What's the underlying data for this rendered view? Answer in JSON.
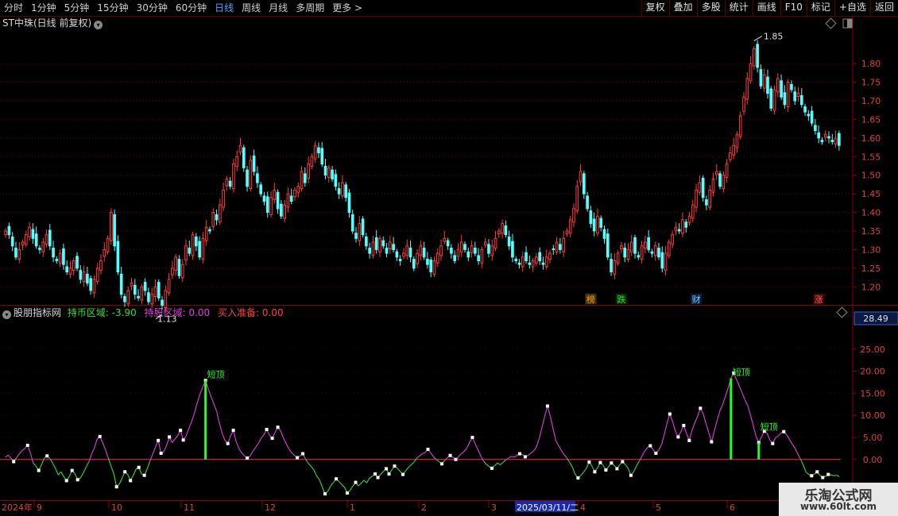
{
  "toolbar": {
    "periods": [
      "分时",
      "1分钟",
      "5分钟",
      "15分钟",
      "30分钟",
      "60分钟",
      "日线",
      "周线",
      "月线",
      "多周期",
      "更多"
    ],
    "active_period": "日线",
    "more_arrow": ">",
    "actions": [
      "复权",
      "叠加",
      "多股",
      "统计",
      "画线",
      "F10",
      "标记",
      "+自选",
      "返回"
    ]
  },
  "main": {
    "title": "ST中珠(日线 前复权)",
    "high_label": "1.85",
    "low_label": "1.13",
    "events": [
      {
        "text": "榜",
        "color": "#e8a020",
        "bg": "#4a3000"
      },
      {
        "text": "跌",
        "color": "#30e030",
        "bg": "#003000"
      },
      {
        "text": "财",
        "color": "#80c8ff",
        "bg": "#002040"
      },
      {
        "text": "涨",
        "color": "#ff6060",
        "bg": "#400000"
      }
    ]
  },
  "indicator": {
    "name": "股朋指标网",
    "holdcash_label": "持币区域: ",
    "holdcash_value": "-3.90",
    "holdstock_label": "持股区域: ",
    "holdstock_value": "0.00",
    "buy_label": "买入准备: ",
    "buy_value": "0.00",
    "current_value": "28.49",
    "short_top_label": "短顶"
  },
  "xaxis": {
    "labels": [
      "2024年",
      "9",
      "10",
      "11",
      "12",
      "1",
      "2",
      "3",
      "2025/03/11/二",
      "4",
      "5",
      "6"
    ]
  },
  "watermark": {
    "line1": "乐淘公式网",
    "line2": "www.60lt.com"
  },
  "chart_data": [
    {
      "type": "candlestick",
      "title": "ST中珠(日线 前复权)",
      "y_ticks": [
        1.2,
        1.25,
        1.3,
        1.35,
        1.4,
        1.45,
        1.5,
        1.55,
        1.6,
        1.65,
        1.7,
        1.75,
        1.8
      ],
      "ylim": [
        1.16,
        1.89
      ],
      "annotations": [
        {
          "text": "1.85",
          "type": "high"
        },
        {
          "text": "1.13",
          "type": "low"
        }
      ],
      "grid": "dotted horizontal",
      "close": [
        1.35,
        1.34,
        1.31,
        1.28,
        1.3,
        1.32,
        1.34,
        1.36,
        1.33,
        1.31,
        1.3,
        1.32,
        1.34,
        1.31,
        1.28,
        1.27,
        1.29,
        1.26,
        1.24,
        1.25,
        1.27,
        1.25,
        1.22,
        1.24,
        1.21,
        1.19,
        1.22,
        1.25,
        1.27,
        1.3,
        1.33,
        1.4,
        1.31,
        1.24,
        1.18,
        1.16,
        1.19,
        1.21,
        1.18,
        1.17,
        1.2,
        1.19,
        1.16,
        1.18,
        1.2,
        1.17,
        1.15,
        1.19,
        1.22,
        1.25,
        1.28,
        1.23,
        1.26,
        1.31,
        1.29,
        1.34,
        1.31,
        1.28,
        1.33,
        1.36,
        1.35,
        1.4,
        1.38,
        1.42,
        1.46,
        1.49,
        1.47,
        1.53,
        1.55,
        1.58,
        1.52,
        1.47,
        1.54,
        1.51,
        1.48,
        1.45,
        1.43,
        1.4,
        1.44,
        1.46,
        1.41,
        1.39,
        1.42,
        1.45,
        1.43,
        1.46,
        1.47,
        1.51,
        1.48,
        1.53,
        1.55,
        1.58,
        1.56,
        1.53,
        1.5,
        1.52,
        1.49,
        1.47,
        1.45,
        1.48,
        1.44,
        1.4,
        1.35,
        1.33,
        1.37,
        1.34,
        1.31,
        1.29,
        1.32,
        1.3,
        1.33,
        1.31,
        1.29,
        1.32,
        1.3,
        1.28,
        1.27,
        1.29,
        1.31,
        1.28,
        1.25,
        1.29,
        1.31,
        1.28,
        1.26,
        1.24,
        1.27,
        1.29,
        1.31,
        1.33,
        1.31,
        1.29,
        1.27,
        1.3,
        1.32,
        1.3,
        1.28,
        1.31,
        1.29,
        1.27,
        1.3,
        1.32,
        1.29,
        1.31,
        1.33,
        1.35,
        1.37,
        1.34,
        1.31,
        1.28,
        1.27,
        1.26,
        1.28,
        1.27,
        1.26,
        1.27,
        1.28,
        1.27,
        1.26,
        1.28,
        1.29,
        1.3,
        1.32,
        1.3,
        1.33,
        1.35,
        1.38,
        1.41,
        1.47,
        1.51,
        1.45,
        1.41,
        1.37,
        1.35,
        1.39,
        1.36,
        1.33,
        1.28,
        1.24,
        1.27,
        1.29,
        1.31,
        1.28,
        1.3,
        1.32,
        1.29,
        1.28,
        1.31,
        1.32,
        1.3,
        1.29,
        1.31,
        1.28,
        1.25,
        1.29,
        1.32,
        1.34,
        1.36,
        1.35,
        1.38,
        1.36,
        1.39,
        1.42,
        1.46,
        1.48,
        1.44,
        1.42,
        1.46,
        1.49,
        1.51,
        1.47,
        1.5,
        1.53,
        1.56,
        1.58,
        1.61,
        1.66,
        1.71,
        1.76,
        1.8,
        1.84,
        1.79,
        1.74,
        1.77,
        1.72,
        1.68,
        1.73,
        1.76,
        1.71,
        1.69,
        1.75,
        1.73,
        1.7,
        1.72,
        1.69,
        1.67,
        1.66,
        1.64,
        1.62,
        1.6,
        1.59,
        1.61,
        1.6,
        1.59,
        1.6,
        1.58
      ]
    },
    {
      "type": "line",
      "title": "股朋指标网",
      "y_ticks": [
        0.0,
        5.0,
        10.0,
        15.0,
        20.0,
        25.0
      ],
      "ylim": [
        -8.5,
        30
      ],
      "zero_line": true,
      "annotations": [
        {
          "text": "短顶"
        },
        {
          "text": "短顶"
        },
        {
          "text": "短顶"
        }
      ],
      "values": [
        0.5,
        1.0,
        0.3,
        -0.5,
        0.4,
        1.2,
        2.0,
        2.5,
        3.2,
        1.5,
        -0.8,
        -1.5,
        -2.5,
        -1.2,
        0.3,
        0.8,
        0.2,
        -0.8,
        -2.0,
        -3.5,
        -2.8,
        -3.9,
        -4.8,
        -3.8,
        -2.5,
        -3.2,
        -4.6,
        -4.2,
        -3.1,
        -1.8,
        -0.6,
        1.2,
        2.6,
        4.6,
        5.2,
        3.8,
        2.2,
        0.4,
        -1.5,
        -3.2,
        -6.2,
        -5.6,
        -4.2,
        -2.8,
        -3.4,
        -4.8,
        -3.6,
        -2.2,
        -1.8,
        -3.3,
        -3.6,
        -2.2,
        -0.4,
        1.2,
        2.8,
        4.3,
        1.4,
        1.8,
        3.2,
        5.1,
        3.8,
        4.6,
        5.4,
        6.6,
        4.4,
        5.3,
        7.0,
        8.6,
        10.5,
        12.8,
        14.8,
        16.4,
        17.9,
        16.0,
        14.2,
        12.6,
        10.9,
        8.2,
        5.9,
        4.3,
        3.6,
        5.3,
        6.6,
        4.1,
        2.5,
        1.5,
        0.8,
        0.3,
        0.7,
        1.8,
        2.7,
        3.6,
        4.8,
        5.6,
        6.8,
        5.5,
        4.8,
        6.1,
        7.3,
        6.5,
        4.9,
        3.6,
        2.4,
        1.5,
        0.9,
        0.4,
        0.8,
        1.3,
        0.1,
        -0.9,
        -1.6,
        -2.4,
        -3.8,
        -4.6,
        -6.3,
        -7.8,
        -7.2,
        -6.0,
        -5.2,
        -4.4,
        -5.0,
        -5.7,
        -6.3,
        -7.6,
        -7.0,
        -6.0,
        -5.2,
        -6.0,
        -5.4,
        -4.7,
        -5.3,
        -4.2,
        -3.8,
        -3.3,
        -4.1,
        -3.4,
        -2.7,
        -2.1,
        -3.3,
        -2.4,
        -1.5,
        -2.0,
        -2.7,
        -3.4,
        -2.6,
        -1.8,
        -1.2,
        -0.6,
        0.3,
        0.8,
        1.3,
        1.6,
        2.3,
        1.5,
        0.6,
        0.0,
        -0.5,
        -1.0,
        -0.3,
        0.4,
        0.9,
        0.5,
        0.0,
        0.6,
        1.3,
        1.8,
        2.6,
        3.9,
        5.0,
        3.5,
        2.2,
        0.8,
        -0.4,
        -1.1,
        -1.6,
        -2.0,
        -1.4,
        -0.8,
        -1.2,
        -0.7,
        -0.1,
        0.3,
        0.7,
        0.5,
        0.9,
        1.3,
        1.1,
        0.6,
        0.9,
        1.4,
        1.9,
        2.8,
        4.7,
        7.2,
        9.8,
        12.1,
        9.8,
        7.0,
        4.3,
        3.1,
        2.0,
        1.1,
        0.3,
        -0.7,
        -1.8,
        -3.4,
        -4.2,
        -3.6,
        -2.9,
        -2.0,
        -0.6,
        -1.5,
        -2.8,
        -1.9,
        -0.7,
        -1.3,
        -2.4,
        -1.6,
        -0.8,
        -1.4,
        -2.1,
        -1.2,
        -0.5,
        -1.2,
        -2.0,
        -3.6,
        -2.8,
        -1.5,
        -0.4,
        0.8,
        1.9,
        2.7,
        3.1,
        2.2,
        1.4,
        2.1,
        3.3,
        5.6,
        8.2,
        10.3,
        8.6,
        6.4,
        5.1,
        6.3,
        7.7,
        5.9,
        4.3,
        6.6,
        8.3,
        9.8,
        11.6,
        10.4,
        8.1,
        6.1,
        4.0,
        6.4,
        8.8,
        11.0,
        12.4,
        14.3,
        16.2,
        18.4,
        19.6,
        18.1,
        16.6,
        15.1,
        13.5,
        12.3,
        10.1,
        7.7,
        5.3,
        3.8,
        5.2,
        6.4,
        5.9,
        4.4,
        3.6,
        4.9,
        5.3,
        6.0,
        6.3,
        5.6,
        4.6,
        3.5,
        2.6,
        1.3,
        0.1,
        -1.3,
        -2.9,
        -3.4,
        -3.7,
        -3.3,
        -2.8,
        -3.6,
        -4.1,
        -3.8,
        -3.4,
        -3.5,
        -3.7,
        -3.6,
        -3.9
      ]
    }
  ]
}
